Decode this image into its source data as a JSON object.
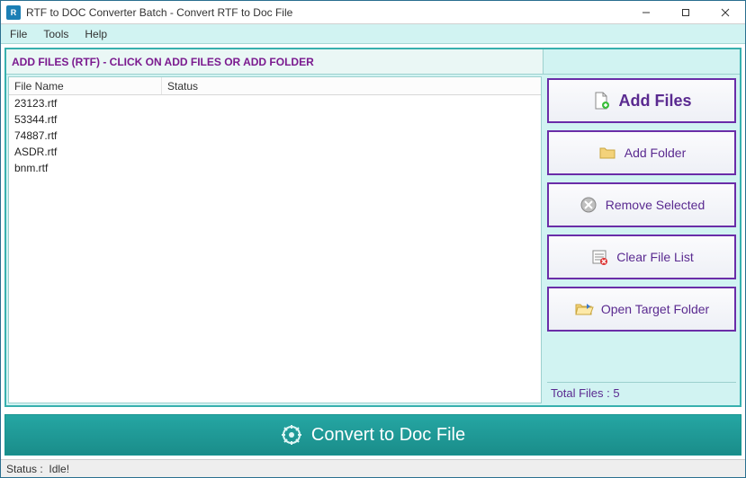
{
  "titlebar": {
    "title": "RTF to DOC Converter Batch -  Convert RTF to Doc File"
  },
  "menu": {
    "file": "File",
    "tools": "Tools",
    "help": "Help"
  },
  "instruction": "ADD FILES (RTF) - CLICK ON ADD FILES OR ADD FOLDER",
  "columns": {
    "filename": "File Name",
    "status": "Status"
  },
  "files": [
    {
      "name": "23123.rtf",
      "status": ""
    },
    {
      "name": "53344.rtf",
      "status": ""
    },
    {
      "name": "74887.rtf",
      "status": ""
    },
    {
      "name": "ASDR.rtf",
      "status": ""
    },
    {
      "name": "bnm.rtf",
      "status": ""
    }
  ],
  "buttons": {
    "add_files": "Add Files",
    "add_folder": "Add Folder",
    "remove_selected": "Remove Selected",
    "clear_list": "Clear File List",
    "open_target": "Open Target Folder"
  },
  "total_files_label": "Total Files : 5",
  "convert": "Convert to Doc File",
  "status": {
    "label": "Status  :",
    "value": "Idle!"
  }
}
